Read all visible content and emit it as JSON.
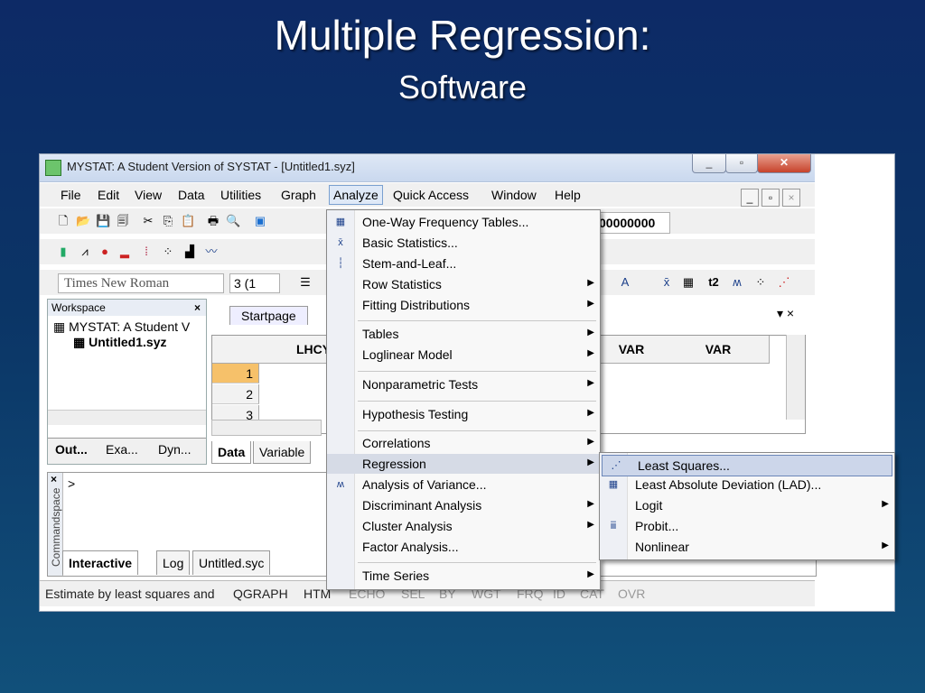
{
  "slide": {
    "title": "Multiple Regression:",
    "subtitle": "Software"
  },
  "window": {
    "title": "MYSTAT: A Student Version of SYSTAT - [Untitled1.syz]",
    "minimize": "_",
    "restore": "▫",
    "close": "✕"
  },
  "menubar": [
    {
      "label": "File"
    },
    {
      "label": "Edit"
    },
    {
      "label": "View"
    },
    {
      "label": "Data"
    },
    {
      "label": "Utilities"
    },
    {
      "label": "Graph"
    },
    {
      "label": "Analyze"
    },
    {
      "label": "Quick Access"
    },
    {
      "label": "Window"
    },
    {
      "label": "Help"
    }
  ],
  "toolbar": {
    "font": "Times New Roman",
    "size": "3 (1",
    "number_field": "00000000",
    "t2_label": "t2"
  },
  "workspace": {
    "header": "Workspace",
    "close": "×",
    "tree_root": "MYSTAT: A Student V",
    "tree_child": "Untitled1.syz",
    "tabs": [
      "Out...",
      "Exa...",
      "Dyn..."
    ]
  },
  "editor": {
    "startpage_tab": "Startpage",
    "columns": [
      "LHCY",
      "VAR",
      "VAR"
    ],
    "rows": [
      "1",
      "2",
      "3"
    ],
    "data_tabs": [
      "Data",
      "Variable"
    ],
    "pin": "▾ ×"
  },
  "command": {
    "side_label": "Commandspace",
    "prompt": ">",
    "close": "×",
    "tabs": [
      "Interactive",
      "Log",
      "Untitled.syc"
    ]
  },
  "status": {
    "message": "Estimate by least squares and",
    "items": [
      "QGRAPH",
      "HTM",
      "ECHO",
      "SEL",
      "BY",
      "WGT",
      "FRQ",
      "ID",
      "CAT",
      "OVR"
    ]
  },
  "analyze_menu": [
    {
      "label": "One-Way Frequency Tables...",
      "icon": "table-icon",
      "glyph": "▦",
      "arrow": false
    },
    {
      "label": "Basic Statistics...",
      "icon": "xbar-icon",
      "glyph": "x̄",
      "arrow": false
    },
    {
      "label": "Stem-and-Leaf...",
      "icon": "stem-leaf-icon",
      "glyph": "┆",
      "arrow": false
    },
    {
      "label": "Row Statistics",
      "icon": "",
      "glyph": "",
      "arrow": true
    },
    {
      "label": "Fitting Distributions",
      "icon": "",
      "glyph": "",
      "arrow": true
    },
    {
      "label": "Tables",
      "icon": "",
      "glyph": "",
      "arrow": true
    },
    {
      "label": "Loglinear Model",
      "icon": "",
      "glyph": "",
      "arrow": true
    },
    {
      "label": "Nonparametric Tests",
      "icon": "",
      "glyph": "",
      "arrow": true
    },
    {
      "label": "Hypothesis Testing",
      "icon": "",
      "glyph": "",
      "arrow": true
    },
    {
      "label": "Correlations",
      "icon": "",
      "glyph": "",
      "arrow": true
    },
    {
      "label": "Regression",
      "icon": "",
      "glyph": "",
      "arrow": true
    },
    {
      "label": "Analysis of Variance...",
      "icon": "anova-icon",
      "glyph": "ʍ",
      "arrow": false
    },
    {
      "label": "Discriminant Analysis",
      "icon": "",
      "glyph": "",
      "arrow": true
    },
    {
      "label": "Cluster Analysis",
      "icon": "",
      "glyph": "",
      "arrow": true
    },
    {
      "label": "Factor Analysis...",
      "icon": "",
      "glyph": "",
      "arrow": false
    },
    {
      "label": "Time Series",
      "icon": "",
      "glyph": "",
      "arrow": true
    }
  ],
  "regression_submenu": [
    {
      "label": "Least Squares...",
      "icon": "scatter-icon",
      "glyph": "⋰",
      "arrow": false
    },
    {
      "label": "Least Absolute Deviation (LAD)...",
      "icon": "table-icon",
      "glyph": "▦",
      "arrow": false
    },
    {
      "label": "Logit",
      "icon": "",
      "glyph": "",
      "arrow": true
    },
    {
      "label": "Probit...",
      "icon": "probit-icon",
      "glyph": "ⅲ",
      "arrow": false
    },
    {
      "label": "Nonlinear",
      "icon": "",
      "glyph": "",
      "arrow": true
    }
  ],
  "colors": {
    "highlight": "#d6dbe6",
    "selected_row": "#f6c16a",
    "slide_bg": "#0d2a66"
  }
}
